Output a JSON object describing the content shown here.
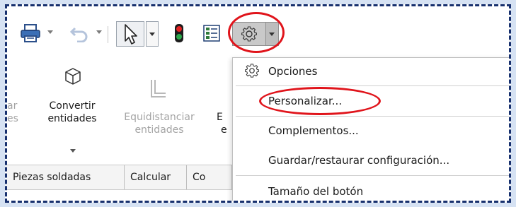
{
  "toolbar": {
    "icons": [
      "printer-icon",
      "undo-icon",
      "select-arrow-icon",
      "traffic-light-icon",
      "options-list-icon",
      "gear-icon"
    ]
  },
  "ribbon": {
    "partial_left_top": "ar",
    "partial_left_bottom": "es",
    "convert_line1": "Convertir",
    "convert_line2": "entidades",
    "offset_line1": "Equidistanciar",
    "offset_line2": "entidades",
    "partial_right_top": "E",
    "partial_right_bottom": "e"
  },
  "tabs": [
    {
      "label": "Piezas soldadas"
    },
    {
      "label": "Calcular"
    },
    {
      "label": "Co"
    }
  ],
  "menu": {
    "items": [
      {
        "label": "Opciones"
      },
      {
        "label": "Personalizar..."
      },
      {
        "label": "Complementos..."
      },
      {
        "label": "Guardar/restaurar configuración..."
      },
      {
        "label": "Tamaño del botón"
      }
    ]
  },
  "colors": {
    "highlight_ring": "#e0141b",
    "frame_border": "#17306e",
    "disabled_text": "#a4a4a4"
  }
}
